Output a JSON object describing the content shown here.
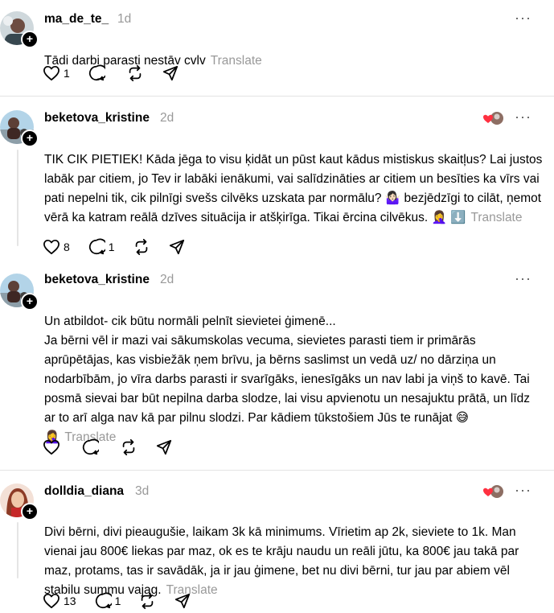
{
  "posts": [
    {
      "username": "ma_de_te_",
      "time": "1d",
      "text": "Tādi darbi parasti nestāv cvlv",
      "translate_label": "Translate",
      "likes": "1",
      "replies": "",
      "avatar_icon": "avatar-photo-icon",
      "liked_by_author": false
    },
    {
      "username": "beketova_kristine",
      "time": "2d",
      "text": "TIK CIK PIETIEK! Kāda jēga to visu ķidāt un pūst kaut kādus mistiskus skaitļus? Lai justos labāk par citiem, jo Tev ir labāki ienākumi, vai salīdzināties ar citiem un besīties ka vīrs vai pati nepelni tik, cik pilnīgi svešs cilvēks uzskata par normālu? 🤷🏻‍♀️ bezjēdzīgi to cilāt, ņemot vērā ka katram reālā dzīves situācija ir atšķirīga. Tikai ērcina cilvēkus. 🤦‍♀️ ⬇️",
      "translate_label": "Translate",
      "likes": "8",
      "replies": "1",
      "avatar_icon": "avatar-photo-icon",
      "liked_by_author": true
    },
    {
      "username": "beketova_kristine",
      "time": "2d",
      "text": "Un atbildot- cik būtu normāli pelnīt sievietei ģimenē...\nJa bērni vēl ir mazi vai sākumskolas vecuma, sievietes parasti tiem ir primārās aprūpētājas, kas visbiežāk ņem brīvu, ja bērns saslimst un vedā uz/ no dārziņa un nodarbībām, jo vīra darbs parasti ir svarīgāks, ienesīgāks un nav labi ja viņš to kavē. Tai posmā sievai bar būt nepilna darba slodze, lai visu apvienotu un nesajuktu prātā, un līdz ar to arī alga nav kā par pilnu slodzi. Par kādiem tūkstošiem Jūs te runājat 😅 🤦‍♀️",
      "translate_label": "Translate",
      "likes": "",
      "replies": "",
      "avatar_icon": "avatar-photo-icon",
      "liked_by_author": false
    },
    {
      "username": "dolldia_diana",
      "time": "3d",
      "text": "Divi bērni, divi pieaugušie, laikam 3k kā minimums. Vīrietim ap 2k, sieviete to 1k. Man vienai jau 800€ liekas par maz, ok es te krāju naudu un reāli jūtu, ka 800€ jau takā par maz, protams, tas ir savādāk, ja ir jau ģimene, bet nu divi bērni, tur jau par abiem vēl stabilu summu vajag.",
      "translate_label": "Translate",
      "likes": "13",
      "replies": "1",
      "avatar_icon": "avatar-photo-icon",
      "liked_by_author": true
    }
  ],
  "icons": {
    "like": "heart-icon",
    "reply": "comment-icon",
    "repost": "repost-icon",
    "share": "send-icon",
    "more": "more-icon",
    "follow": "plus-icon"
  },
  "more_label": "···",
  "follow_label": "+",
  "colors": {
    "muted": "#999999",
    "divider": "#e3e3e3",
    "heart_red": "#ff3040"
  }
}
